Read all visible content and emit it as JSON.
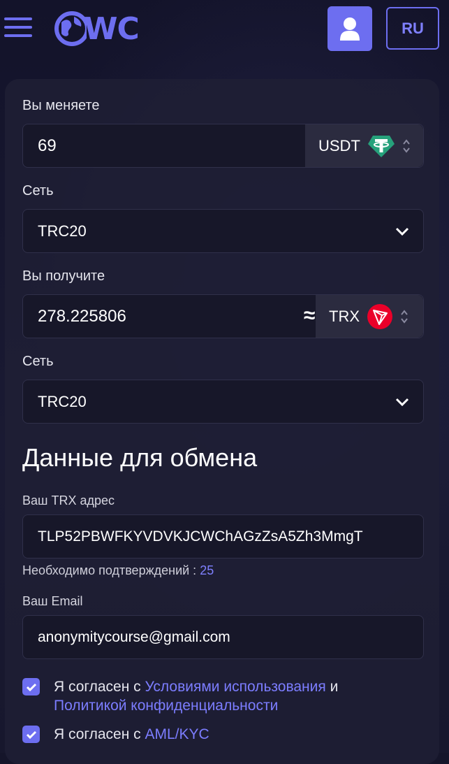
{
  "header": {
    "logo_text": "WC",
    "lang_label": "RU"
  },
  "exchange": {
    "give_label": "Вы меняете",
    "give_amount": "69",
    "give_currency": "USDT",
    "give_network_label": "Сеть",
    "give_network": "TRC20",
    "get_label": "Вы получите",
    "get_amount": "278.225806",
    "approx_symbol": "≈",
    "get_currency": "TRX",
    "get_network_label": "Сеть",
    "get_network": "TRC20"
  },
  "details": {
    "title": "Данные для обмена",
    "address_label": "Ваш TRX адрес",
    "address_value": "TLP52PBWFKYVDVKJCWChAGzZsA5Zh3MmgT",
    "confirmations_label": "Необходимо подтверждений : ",
    "confirmations_value": "25",
    "email_label": "Ваш Email",
    "email_value": "anonymitycourse@gmail.com"
  },
  "agreements": {
    "terms_prefix": "Я согласен с ",
    "terms_link": "Условиями использования",
    "terms_and": " и",
    "privacy_link": "Политикой конфиденциальности",
    "aml_prefix": "Я согласен с ",
    "aml_link": "AML/KYC"
  },
  "colors": {
    "accent": "#6d6ef0",
    "usdt": "#26a17b",
    "trx": "#eb0029"
  },
  "icons": {
    "menu": "hamburger-icon",
    "user": "user-icon",
    "usdt": "tether-icon",
    "trx": "tron-icon"
  }
}
